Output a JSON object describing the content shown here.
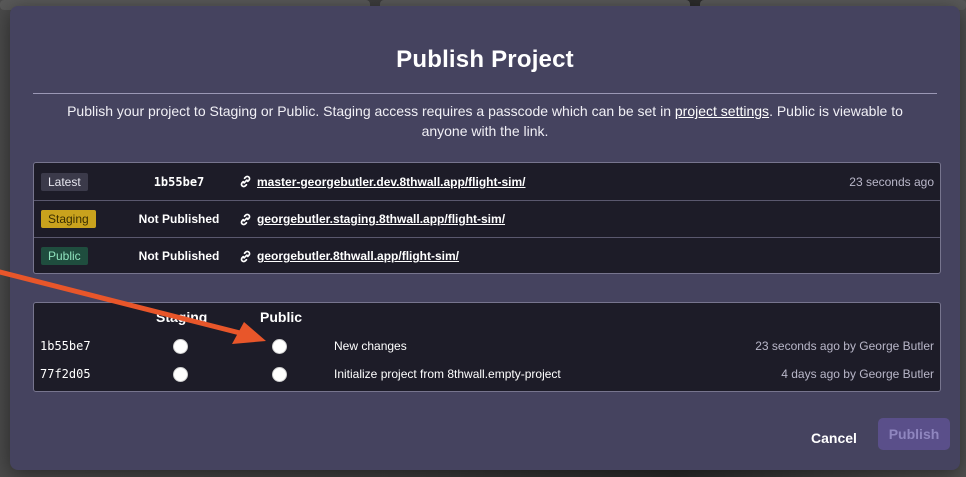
{
  "modal": {
    "title": "Publish Project",
    "description_pre": "Publish your project to Staging or Public. Staging access requires a passcode which can be set in ",
    "description_link": "project settings",
    "description_post": ". Public is viewable to anyone with the link."
  },
  "environments": [
    {
      "badge": "Latest",
      "commit": "1b55be7",
      "url": "master-georgebutler.dev.8thwall.app/flight-sim/",
      "time": "23 seconds ago"
    },
    {
      "badge": "Staging",
      "commit": "Not Published",
      "url": "georgebutler.staging.8thwall.app/flight-sim/",
      "time": ""
    },
    {
      "badge": "Public",
      "commit": "Not Published",
      "url": "georgebutler.8thwall.app/flight-sim/",
      "time": ""
    }
  ],
  "commits": {
    "headers": {
      "staging": "Staging",
      "public": "Public"
    },
    "rows": [
      {
        "hash": "1b55be7",
        "message": "New changes",
        "meta": "23 seconds ago by George Butler"
      },
      {
        "hash": "77f2d05",
        "message": "Initialize project from 8thwall.empty-project",
        "meta": "4 days ago by George Butler"
      }
    ]
  },
  "actions": {
    "cancel": "Cancel",
    "publish": "Publish"
  },
  "colors": {
    "modal_bg": "#45435f",
    "table_bg": "#1d1c28",
    "staging_badge": "#c9a21d",
    "public_badge": "#1f4d3e",
    "arrow": "#e8562a",
    "publish_disabled": "#5a4f8a"
  },
  "icons": {
    "url_icon": "link-icon",
    "annotation": "arrow-annotation"
  }
}
